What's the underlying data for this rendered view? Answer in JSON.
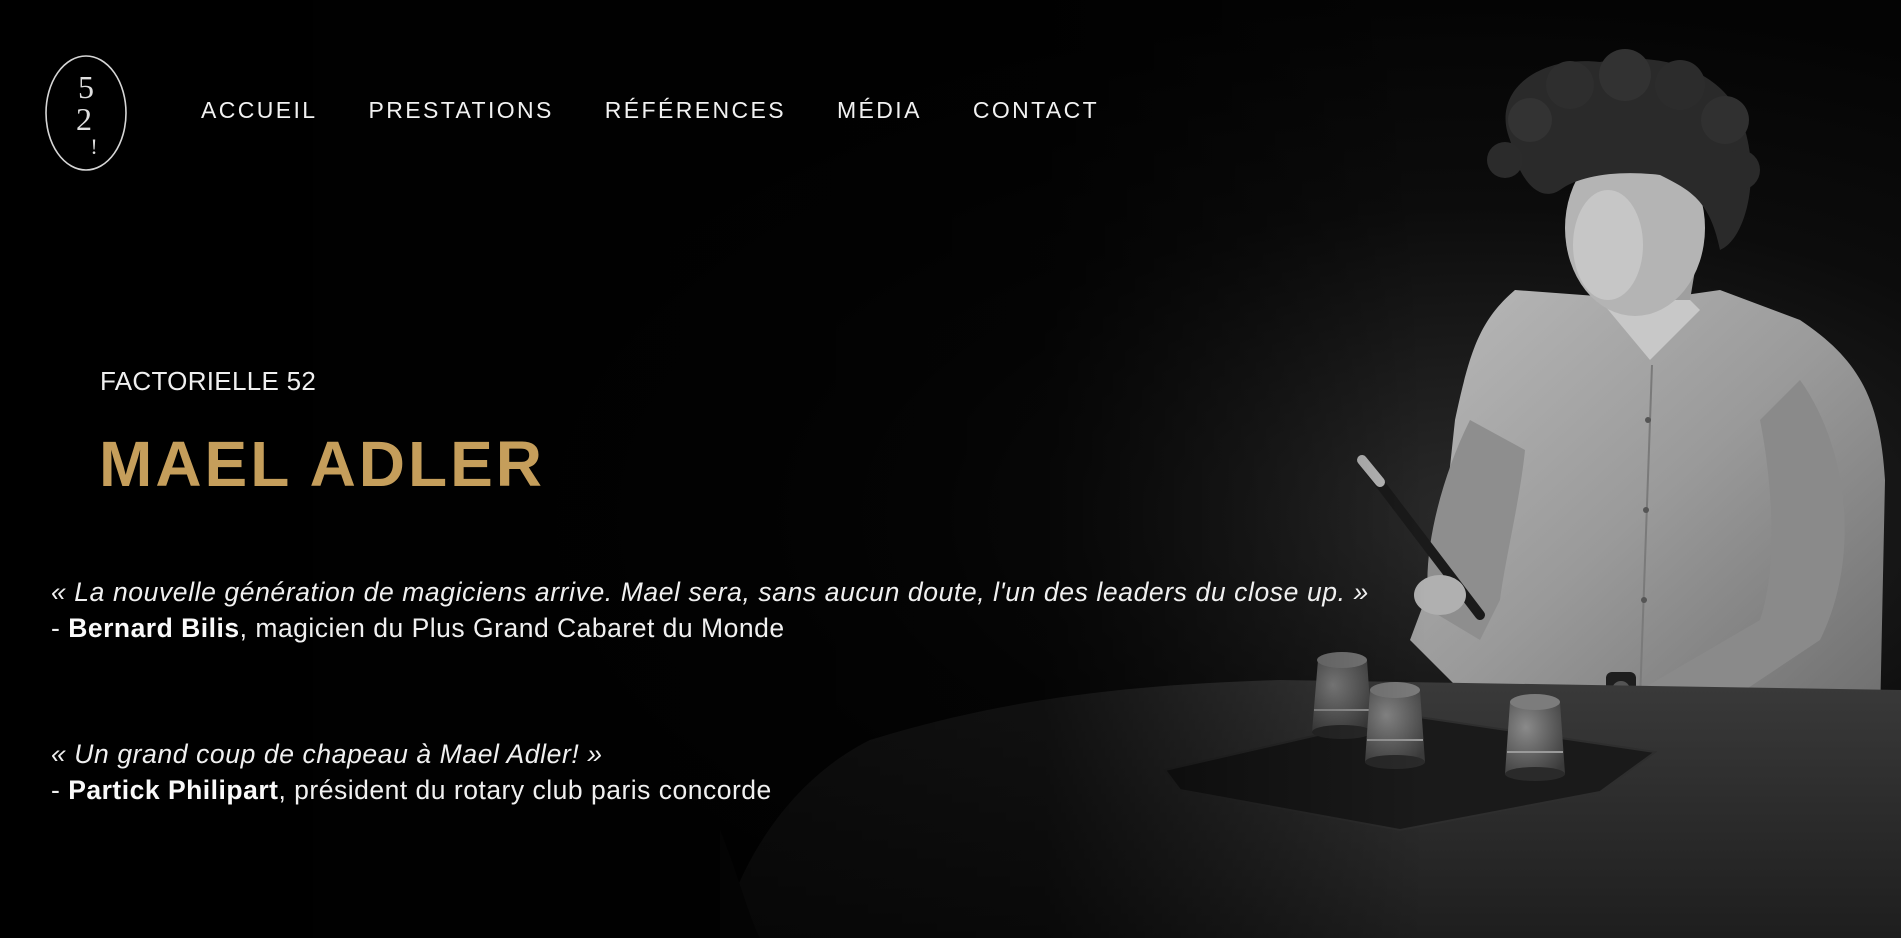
{
  "logo": {
    "text_top": "5",
    "text_mid": "2",
    "text_bottom": "!"
  },
  "nav": {
    "items": [
      {
        "label": "ACCUEIL"
      },
      {
        "label": "PRESTATIONS"
      },
      {
        "label": "RÉFÉRENCES"
      },
      {
        "label": "MÉDIA"
      },
      {
        "label": "CONTACT"
      }
    ]
  },
  "hero": {
    "eyebrow": "FACTORIELLE 52",
    "title": "MAEL ADLER"
  },
  "testimonials": [
    {
      "quote": "« La nouvelle génération de magiciens arrive. Mael sera, sans aucun doute, l'un des leaders du close up. »",
      "dash": "- ",
      "author": "Bernard Bilis",
      "role": ", magicien du Plus Grand Cabaret du Monde"
    },
    {
      "quote": "« Un grand coup de chapeau à Mael Adler! »",
      "dash": "- ",
      "author": "Partick Philipart",
      "role": ", président du rotary club paris concorde"
    }
  ],
  "colors": {
    "accent": "#c59e5b",
    "background": "#000000",
    "text": "#f0f0f0"
  }
}
